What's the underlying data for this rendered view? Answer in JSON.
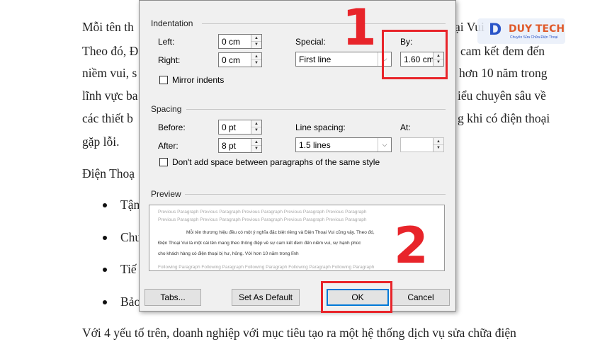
{
  "document": {
    "lines": [
      "Mỗi tên th",
      "Theo đó, Đ",
      "niềm vui, s",
      "lĩnh vực ba",
      "các thiết b",
      "gặp lỗi.",
      "Điện Thoạ"
    ],
    "right_fragments": [
      "ại Vui",
      "cam kết đem đến",
      "hơn 10 năm trong",
      "iểu chuyên sâu về",
      "g khi có điện thoại"
    ],
    "bullets": [
      "Tận",
      "Chu",
      "Tiế",
      "Bảo"
    ],
    "bottom_lines": [
      "Với 4 yếu tố trên, doanh nghiệp với mục tiêu tạo ra một hệ thống dịch vụ sửa chữa điện"
    ]
  },
  "logo": {
    "mark": "D",
    "word": "DUY TECH",
    "tagline": "Chuyên Sửa Chữa Điện Thoại"
  },
  "dialog": {
    "indentation": {
      "title": "Indentation",
      "left_label": "Left:",
      "left_value": "0 cm",
      "right_label": "Right:",
      "right_value": "0 cm",
      "special_label": "Special:",
      "special_value": "First line",
      "by_label": "By:",
      "by_value": "1.60 cm",
      "mirror_label": "Mirror indents",
      "mirror_checked": false
    },
    "spacing": {
      "title": "Spacing",
      "before_label": "Before:",
      "before_value": "0 pt",
      "after_label": "After:",
      "after_value": "8 pt",
      "line_spacing_label": "Line spacing:",
      "line_spacing_value": "1.5 lines",
      "at_label": "At:",
      "at_value": "",
      "dont_add_label": "Don't add space between paragraphs of the same style",
      "dont_add_checked": false
    },
    "preview": {
      "title": "Preview",
      "prev_para": "Previous Paragraph Previous Paragraph Previous Paragraph Previous Paragraph Previous Paragraph",
      "prev_para2": "Previous Paragraph Previous Paragraph Previous Paragraph Previous Paragraph Previous Paragraph",
      "sample1": "Mỗi tên thương hiệu đều có một ý nghĩa đặc biệt riêng và Điện Thoại Vui cũng vậy. Theo đó,",
      "sample2": "Điện Thoại Vui là một cái tên mang theo thông điệp về sự cam kết đem đến niềm vui, sự hạnh phúc",
      "sample3": "cho khách hàng có điện thoại bị hư, hỏng. Với hơn 10 năm trong lĩnh",
      "next_para": "Following Paragraph Following Paragraph Following Paragraph Following Paragraph Following Paragraph"
    },
    "buttons": {
      "tabs": "Tabs...",
      "default": "Set As Default",
      "ok": "OK",
      "cancel": "Cancel"
    }
  },
  "annotations": {
    "step1": "1",
    "step2": "2",
    "highlight_color": "#e8242a"
  }
}
